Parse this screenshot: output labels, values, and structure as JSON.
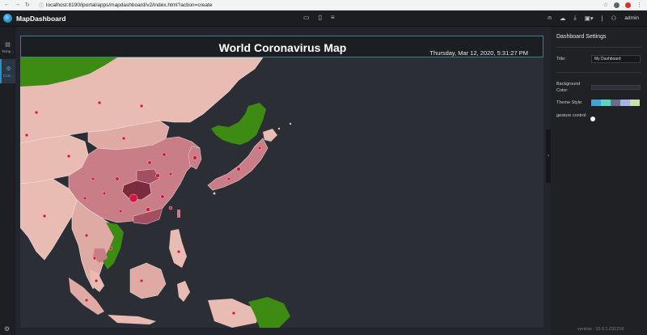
{
  "browser": {
    "url": "localhost:8190/iportal/apps/mapdashboard/v2/index.html?action=create"
  },
  "app": {
    "name": "MapDashboard",
    "user": "admin"
  },
  "sidebar": {
    "items": [
      {
        "label": "Temp...",
        "icon": "template-icon"
      },
      {
        "label": "Com...",
        "icon": "component-icon"
      }
    ]
  },
  "dashboard": {
    "title": "World Coronavirus Map",
    "datetime": "Thursday, Mar 12, 2020, 5:31:27 PM"
  },
  "settings": {
    "heading": "Dashboard Settings",
    "title_label": "Title:",
    "title_value": "My Dashboard",
    "bg_label": "Background Color:",
    "theme_label": "Theme Style:",
    "gesture_label": "gesture control:",
    "theme_colors": [
      "#3ea4dc",
      "#5fd3c6",
      "#6b6f8c",
      "#a8b4e6",
      "#c7e3a7"
    ]
  },
  "footer": {
    "version": "version : 10.0.1.031216"
  },
  "colors": {
    "accent": "#2a8ecf",
    "land_light": "#e9bcb3",
    "land_mid": "#c87d87",
    "land_dark": "#8e3d4d",
    "land_green": "#3d8b12",
    "marker": "#d4153d"
  }
}
